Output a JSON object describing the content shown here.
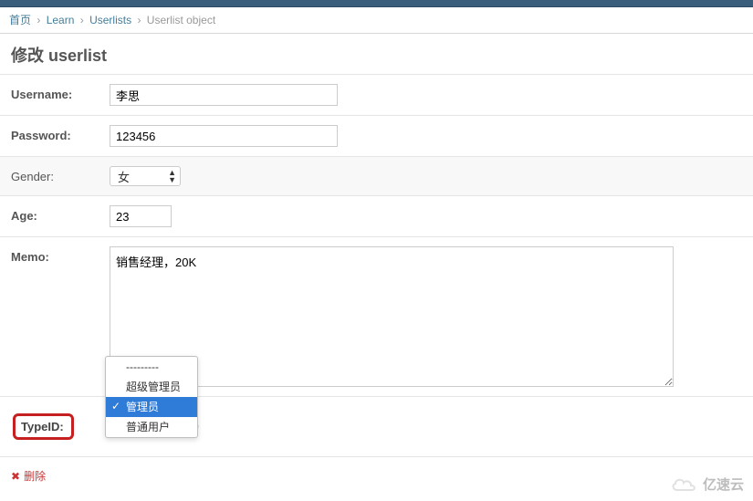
{
  "breadcrumb": {
    "home": "首页",
    "app": "Learn",
    "model": "Userlists",
    "object": "Userlist object"
  },
  "page_title": "修改 userlist",
  "fields": {
    "username": {
      "label": "Username:",
      "value": "李思"
    },
    "password": {
      "label": "Password:",
      "value": "123456"
    },
    "gender": {
      "label": "Gender:",
      "value": "女"
    },
    "age": {
      "label": "Age:",
      "value": "23"
    },
    "memo": {
      "label": "Memo:",
      "value": "销售经理，20K"
    },
    "typeid": {
      "label": "TypeID:"
    }
  },
  "typeid_options": {
    "dash": "---------",
    "super_admin": "超级管理员",
    "admin": "管理员",
    "normal_user": "普通用户"
  },
  "actions": {
    "delete": "删除"
  },
  "watermark": "亿速云"
}
